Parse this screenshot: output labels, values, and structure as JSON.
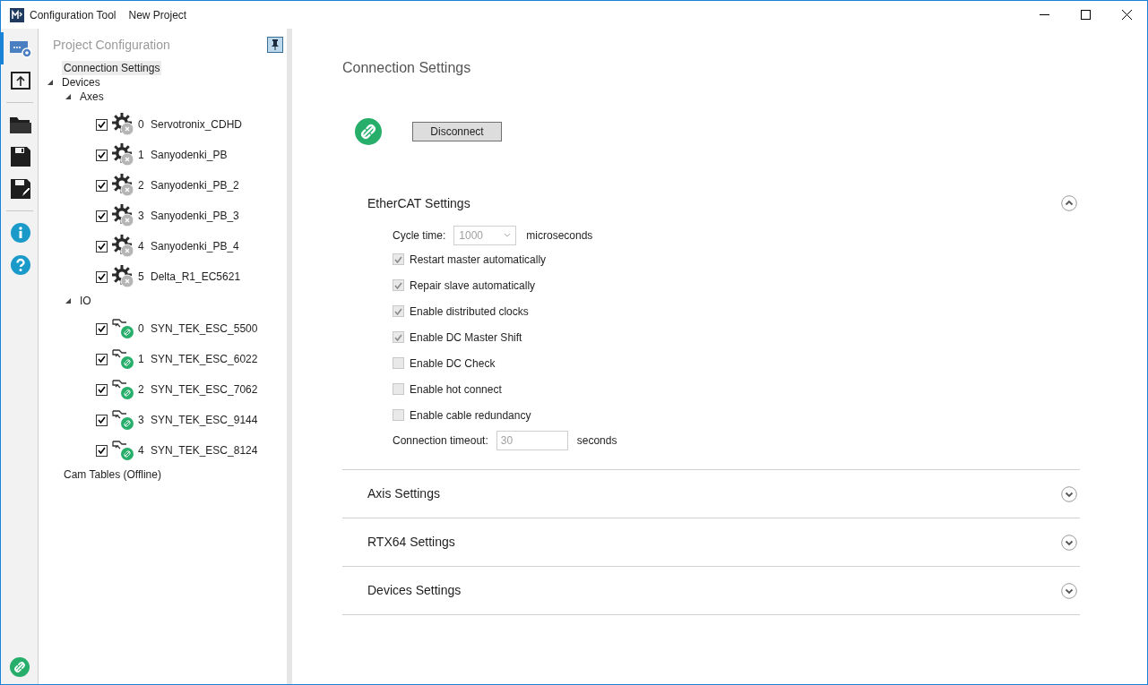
{
  "window": {
    "title": "Configuration Tool",
    "project": "New Project"
  },
  "rail": [
    {
      "kind": "config",
      "selected": true
    },
    {
      "kind": "upload",
      "selected": false
    },
    {
      "kind": "open",
      "selected": false
    },
    {
      "kind": "save",
      "selected": false
    },
    {
      "kind": "saveas",
      "selected": false
    },
    {
      "kind": "info",
      "selected": false
    },
    {
      "kind": "help",
      "selected": false
    }
  ],
  "rail_status": {
    "connected": true
  },
  "panel": {
    "title": "Project Configuration"
  },
  "tree": [
    {
      "label": "Connection Settings",
      "selected": true
    },
    {
      "label": "Devices",
      "selected": false,
      "expanded": true,
      "children": [
        {
          "label": "Axes",
          "selected": false,
          "expanded": true,
          "devices": [
            {
              "index": "0",
              "name": "Servotronix_CDHD",
              "checked": true,
              "kind": "axis"
            },
            {
              "index": "1",
              "name": "Sanyodenki_PB",
              "checked": true,
              "kind": "axis"
            },
            {
              "index": "2",
              "name": "Sanyodenki_PB_2",
              "checked": true,
              "kind": "axis"
            },
            {
              "index": "3",
              "name": "Sanyodenki_PB_3",
              "checked": true,
              "kind": "axis"
            },
            {
              "index": "4",
              "name": "Sanyodenki_PB_4",
              "checked": true,
              "kind": "axis"
            },
            {
              "index": "5",
              "name": "Delta_R1_EC5621",
              "checked": true,
              "kind": "axis"
            }
          ]
        },
        {
          "label": "IO",
          "selected": false,
          "expanded": true,
          "devices": [
            {
              "index": "0",
              "name": "SYN_TEK_ESC_5500",
              "checked": true,
              "kind": "io"
            },
            {
              "index": "1",
              "name": "SYN_TEK_ESC_6022",
              "checked": true,
              "kind": "io"
            },
            {
              "index": "2",
              "name": "SYN_TEK_ESC_7062",
              "checked": true,
              "kind": "io"
            },
            {
              "index": "3",
              "name": "SYN_TEK_ESC_9144",
              "checked": true,
              "kind": "io"
            },
            {
              "index": "4",
              "name": "SYN_TEK_ESC_8124",
              "checked": true,
              "kind": "io"
            }
          ]
        }
      ]
    },
    {
      "label": "Cam Tables (Offline)",
      "selected": false
    }
  ],
  "main": {
    "title": "Connection Settings",
    "connected": true,
    "button": "Disconnect"
  },
  "sections": [
    {
      "title": "EtherCAT Settings",
      "expanded": true,
      "cycle": {
        "label": "Cycle time:",
        "value": "1000",
        "unit": "microseconds"
      },
      "options": [
        {
          "label": "Restart master automatically",
          "checked": true
        },
        {
          "label": "Repair slave automatically",
          "checked": true
        },
        {
          "label": "Enable distributed clocks",
          "checked": true
        },
        {
          "label": "Enable DC Master Shift",
          "checked": true
        },
        {
          "label": "Enable DC Check",
          "checked": false
        },
        {
          "label": "Enable hot connect",
          "checked": false
        },
        {
          "label": "Enable cable redundancy",
          "checked": false
        }
      ],
      "timeout": {
        "label": "Connection timeout:",
        "value": "30",
        "unit": "seconds"
      }
    },
    {
      "title": "Axis Settings",
      "expanded": false
    },
    {
      "title": "RTX64 Settings",
      "expanded": false
    },
    {
      "title": "Devices Settings",
      "expanded": false
    }
  ]
}
